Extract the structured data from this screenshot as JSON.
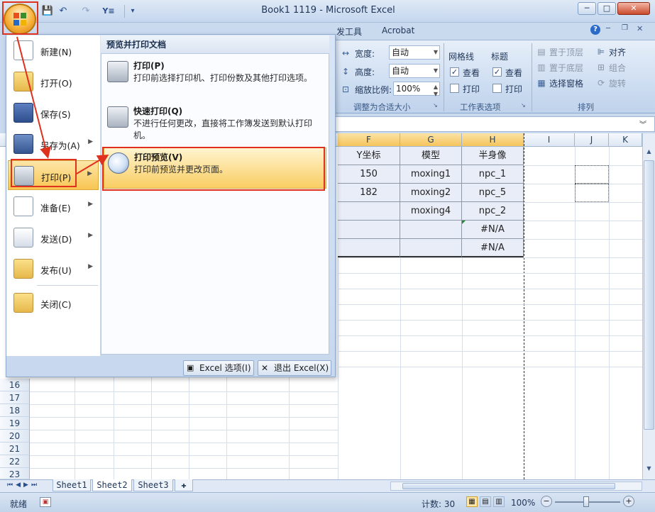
{
  "window": {
    "title": "Book1 1119 - Microsoft Excel",
    "buttons": [
      "─",
      "□",
      "✕"
    ]
  },
  "qat": {
    "save": "💾",
    "undo": "↶",
    "redo": "↷",
    "filter": "Y≡",
    "more": "▾"
  },
  "ribbon": {
    "tabs": [
      "发工具",
      "Acrobat"
    ],
    "help": "?",
    "page_setup": {
      "width_label": "宽度:",
      "width_value": "自动",
      "height_label": "高度:",
      "height_value": "自动",
      "scale_label": "缩放比例:",
      "scale_value": "100%",
      "group_label": "调整为合适大小"
    },
    "sheet_options": {
      "gridlines": "网格线",
      "headings": "标题",
      "view": "查看",
      "print": "打印",
      "group_label": "工作表选项"
    },
    "arrange": {
      "bring_front": "置于顶层",
      "send_back": "置于底层",
      "selection_pane": "选择窗格",
      "align": "对齐",
      "group": "组合",
      "rotate": "旋转",
      "group_label": "排列"
    }
  },
  "grid": {
    "columns": [
      "F",
      "G",
      "H",
      "I",
      "J",
      "K"
    ],
    "header_row": [
      "Y坐标",
      "模型",
      "半身像"
    ],
    "rows": [
      [
        "150",
        "moxing1",
        "npc_1"
      ],
      [
        "182",
        "moxing2",
        "npc_5"
      ],
      [
        "",
        "moxing4",
        "npc_2"
      ],
      [
        "",
        "",
        "#N/A"
      ],
      [
        "",
        "",
        "#N/A"
      ]
    ],
    "row_numbers": [
      "16",
      "17",
      "18",
      "19",
      "20",
      "21",
      "22",
      "23"
    ]
  },
  "office_menu": {
    "items": [
      {
        "label": "新建(N)",
        "icon": "new-file-icon"
      },
      {
        "label": "打开(O)",
        "icon": "open-folder-icon"
      },
      {
        "label": "保存(S)",
        "icon": "save-disk-icon"
      },
      {
        "label": "另存为(A)",
        "icon": "save-as-icon"
      },
      {
        "label": "打印(P)",
        "icon": "printer-icon"
      },
      {
        "label": "准备(E)",
        "icon": "prepare-icon"
      },
      {
        "label": "发送(D)",
        "icon": "send-icon"
      },
      {
        "label": "发布(U)",
        "icon": "publish-icon"
      },
      {
        "label": "关闭(C)",
        "icon": "close-folder-icon"
      }
    ],
    "submenu_title": "预览并打印文档",
    "submenu": [
      {
        "title": "打印(P)",
        "desc": "打印前选择打印机、打印份数及其他打印选项。"
      },
      {
        "title": "快速打印(Q)",
        "desc": "不进行任何更改，直接将工作簿发送到默认打印机。"
      },
      {
        "title": "打印预览(V)",
        "desc": "打印前预览并更改页面。"
      }
    ],
    "options_button": "Excel 选项(I)",
    "exit_button": "退出 Excel(X)"
  },
  "sheet_tabs": [
    "Sheet1",
    "Sheet2",
    "Sheet3"
  ],
  "status": {
    "ready": "就绪",
    "count": "计数: 30",
    "zoom": "100%"
  },
  "colors": {
    "highlight": "#f8c552",
    "annotation": "#e0301e"
  }
}
